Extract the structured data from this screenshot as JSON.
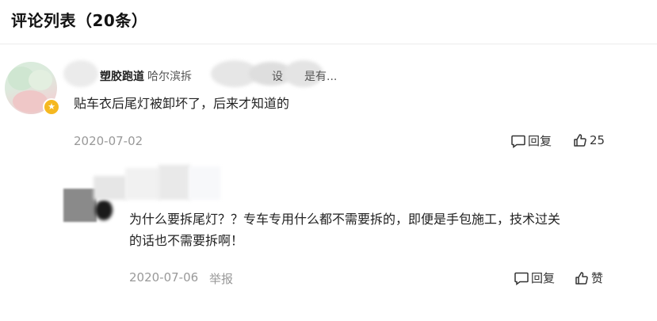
{
  "header": {
    "title": "评论列表（20条）"
  },
  "comment": {
    "username": "塑胶跑道",
    "user_desc": "哈尔滨拆",
    "user_desc_tail": "设",
    "user_desc_tail2": "是有...",
    "text": "贴车衣后尾灯被卸坏了，后来才知道的",
    "date": "2020-07-02",
    "reply_label": "回复",
    "like_count": "25"
  },
  "reply": {
    "text_line1": "为什么要拆尾灯？？专车专用什么都不需要拆的，即便是手包施工，技术过关",
    "text_line2": "的话也不需要拆啊！",
    "date": "2020-07-06",
    "report_label": "举报",
    "reply_label": "回复",
    "like_label": "赞"
  },
  "icons": {
    "reply": "comment-bubble-icon",
    "like": "thumbs-up-icon",
    "badge": "vip-star-icon"
  },
  "colors": {
    "badge": "#f5b821",
    "meta": "#999999"
  }
}
